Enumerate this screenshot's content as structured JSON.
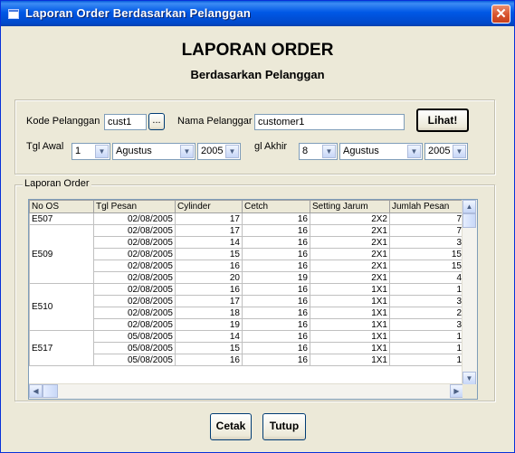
{
  "window": {
    "title": "Laporan Order Berdasarkan Pelanggan",
    "close_glyph": "✕"
  },
  "header": {
    "title": "LAPORAN ORDER",
    "subtitle": "Berdasarkan Pelanggan"
  },
  "filter": {
    "kode_label": "Kode Pelanggan",
    "kode_value": "cust1",
    "browse_label": "...",
    "nama_label": "Nama Pelanggar",
    "nama_value": "customer1",
    "lihat_label": "Lihat!",
    "tgl_awal_label": "Tgl Awal",
    "tgl_awal_day": "1",
    "tgl_awal_month": "Agustus",
    "tgl_awal_year": "2005",
    "tgl_akhir_label": "gl Akhir",
    "tgl_akhir_day": "8",
    "tgl_akhir_month": "Agustus",
    "tgl_akhir_year": "2005"
  },
  "order_frame": {
    "legend": "Laporan Order"
  },
  "table": {
    "columns": [
      "No OS",
      "Tgl Pesan",
      "Cylinder",
      "Cetch",
      "Setting Jarum",
      "Jumlah Pesan"
    ],
    "groups": [
      {
        "no_os": "E507",
        "rows": [
          [
            "02/08/2005",
            "17",
            "16",
            "2X2",
            "7"
          ]
        ]
      },
      {
        "no_os": "E509",
        "rows": [
          [
            "02/08/2005",
            "17",
            "16",
            "2X1",
            "7"
          ],
          [
            "02/08/2005",
            "14",
            "16",
            "2X1",
            "3"
          ],
          [
            "02/08/2005",
            "15",
            "16",
            "2X1",
            "15"
          ],
          [
            "02/08/2005",
            "16",
            "16",
            "2X1",
            "15"
          ],
          [
            "02/08/2005",
            "20",
            "19",
            "2X1",
            "4"
          ]
        ]
      },
      {
        "no_os": "E510",
        "rows": [
          [
            "02/08/2005",
            "16",
            "16",
            "1X1",
            "1"
          ],
          [
            "02/08/2005",
            "17",
            "16",
            "1X1",
            "3"
          ],
          [
            "02/08/2005",
            "18",
            "16",
            "1X1",
            "2"
          ],
          [
            "02/08/2005",
            "19",
            "16",
            "1X1",
            "3"
          ]
        ]
      },
      {
        "no_os": "E517",
        "rows": [
          [
            "05/08/2005",
            "14",
            "16",
            "1X1",
            "1"
          ],
          [
            "05/08/2005",
            "15",
            "16",
            "1X1",
            "1"
          ],
          [
            "05/08/2005",
            "16",
            "16",
            "1X1",
            "1"
          ]
        ]
      }
    ]
  },
  "footer": {
    "cetak_label": "Cetak",
    "tutup_label": "Tutup"
  },
  "icons": {
    "dropdown": "▼",
    "scroll_up": "▲",
    "scroll_down": "▼",
    "scroll_left": "◀",
    "scroll_right": "▶"
  }
}
